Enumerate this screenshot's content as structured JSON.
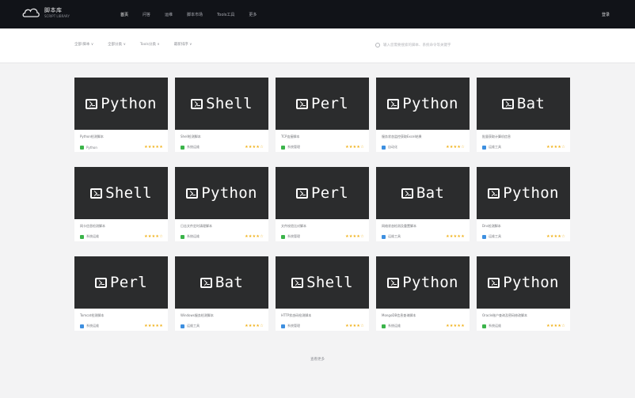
{
  "header": {
    "logo_title": "脚本库",
    "logo_subtitle": "SCRIPT LIBRARY",
    "nav": [
      {
        "label": "首页",
        "active": true
      },
      {
        "label": "问答",
        "active": false
      },
      {
        "label": "运维",
        "active": false
      },
      {
        "label": "脚本市场",
        "active": false
      },
      {
        "label": "Tools工具",
        "active": false
      },
      {
        "label": "更多",
        "active": false
      }
    ],
    "login_label": "登录"
  },
  "filters": {
    "items": [
      "全部·脚本 ∨",
      "全部分类 ∨",
      "Tools分类 ∨",
      "最新排序 ∨"
    ],
    "search_placeholder": "输入您需要搜索的脚本、系统命令等关键字"
  },
  "cards": [
    {
      "lang": "Python",
      "title": "Python检测脚本",
      "author": "Python",
      "badge_color": "#3bb44a",
      "stars": "★★★★★"
    },
    {
      "lang": "Shell",
      "title": "Shell检测脚本",
      "author": "系统运维",
      "badge_color": "#3bb44a",
      "stars": "★★★★☆"
    },
    {
      "lang": "Perl",
      "title": "TCP连接脚本",
      "author": "系统管理",
      "badge_color": "#3bb44a",
      "stars": "★★★★☆"
    },
    {
      "lang": "Python",
      "title": "服务状态监控获取Excel结果",
      "author": "自动化",
      "badge_color": "#3d8fe0",
      "stars": "★★★★☆"
    },
    {
      "lang": "Bat",
      "title": "批量获取计算机信息",
      "author": "运维工具",
      "badge_color": "#3d8fe0",
      "stars": "★★★★☆"
    },
    {
      "lang": "Shell",
      "title": "网卡信息检测脚本",
      "author": "系统运维",
      "badge_color": "#3bb44a",
      "stars": "★★★★☆"
    },
    {
      "lang": "Python",
      "title": "日志文件定时清理脚本",
      "author": "系统运维",
      "badge_color": "#3bb44a",
      "stars": "★★★★☆"
    },
    {
      "lang": "Perl",
      "title": "文件校验比对脚本",
      "author": "系统管理",
      "badge_color": "#3bb44a",
      "stars": "★★★★☆"
    },
    {
      "lang": "Bat",
      "title": "网络状态检测及重置脚本",
      "author": "运维工具",
      "badge_color": "#3d8fe0",
      "stars": "★★★★★"
    },
    {
      "lang": "Python",
      "title": "Dns检测脚本",
      "author": "运维工具",
      "badge_color": "#3d8fe0",
      "stars": "★★★★☆"
    },
    {
      "lang": "Perl",
      "title": "Tomcat检测脚本",
      "author": "系统运维",
      "badge_color": "#3d8fe0",
      "stars": "★★★★★"
    },
    {
      "lang": "Bat",
      "title": "Windows服务检测脚本",
      "author": "运维工具",
      "badge_color": "#3d8fe0",
      "stars": "★★★★☆"
    },
    {
      "lang": "Shell",
      "title": "HTTP状态码检测脚本",
      "author": "系统管理",
      "badge_color": "#3d8fe0",
      "stars": "★★★★☆"
    },
    {
      "lang": "Python",
      "title": "MongoDB信息查询脚本",
      "author": "系统运维",
      "badge_color": "#3bb44a",
      "stars": "★★★★★"
    },
    {
      "lang": "Python",
      "title": "Oracle账户查询及密码修改脚本",
      "author": "系统运维",
      "badge_color": "#3bb44a",
      "stars": "★★★★☆"
    }
  ],
  "load_more": "查看更多"
}
